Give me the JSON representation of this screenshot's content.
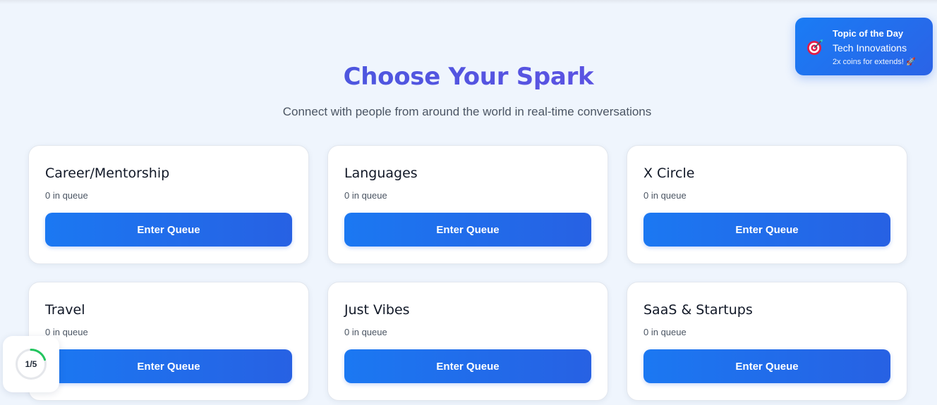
{
  "page": {
    "title": "Choose Your Spark",
    "subtitle": "Connect with people from around the world in real-time conversations"
  },
  "topic_of_day": {
    "heading": "Topic of the Day",
    "topic": "Tech Innovations",
    "bonus": "2x coins for extends! 🚀",
    "icon": "target-icon"
  },
  "categories": [
    {
      "title": "Career/Mentorship",
      "queue": "0 in queue",
      "button": "Enter Queue"
    },
    {
      "title": "Languages",
      "queue": "0 in queue",
      "button": "Enter Queue"
    },
    {
      "title": "X Circle",
      "queue": "0 in queue",
      "button": "Enter Queue"
    },
    {
      "title": "Travel",
      "queue": "0 in queue",
      "button": "Enter Queue"
    },
    {
      "title": "Just Vibes",
      "queue": "0 in queue",
      "button": "Enter Queue"
    },
    {
      "title": "SaaS & Startups",
      "queue": "0 in queue",
      "button": "Enter Queue"
    }
  ],
  "progress": {
    "label": "1/5",
    "fraction": 0.2
  },
  "colors": {
    "title_accent": "#4f46e5",
    "button": "#1d72f0",
    "progress": "#22c55e"
  }
}
